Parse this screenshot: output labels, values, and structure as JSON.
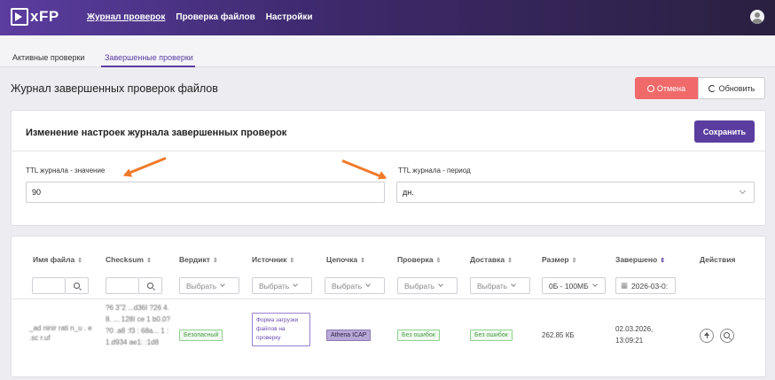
{
  "app": {
    "logo_text": "xFP"
  },
  "topnav": [
    "Журнал проверок",
    "Проверка файлов",
    "Настройки"
  ],
  "tabs": [
    "Активные проверки",
    "Завершенные проверки"
  ],
  "page": {
    "title": "Журнал завершенных проверок файлов",
    "cancel_label": "Отмена",
    "refresh_label": "Обновить"
  },
  "settings": {
    "title": "Изменение настроек журнала завершенных проверок",
    "save_label": "Сохранить",
    "ttl_value_label": "TTL журнала - значение",
    "ttl_value": "90",
    "ttl_period_label": "TTL журнала - период",
    "ttl_period": "дн."
  },
  "table": {
    "columns": [
      "Имя файла",
      "Checksum",
      "Вердикт",
      "Источник",
      "Цепочка",
      "Проверка",
      "Доставка",
      "Размер",
      "Завершено",
      "Действия"
    ],
    "filters": {
      "select_placeholder": "Выбрать",
      "size_filter": "0Б - 100МБ",
      "date_filter": "2026-03-0:"
    },
    "rows": [
      {
        "file_name": "_ad ninir rati n_u . e .sc r.uf",
        "checksum": "?6 3\"2 ...d36I ?26 4. 8. ... 128I ce 1 b0.0? ?0 .a8 :f3 : 68a... 1 : 1.d934 ae1: :1d8",
        "verdict": "Безопасный",
        "source": "Форма загрузки файлов на проверку",
        "chain": "Athena ICAP",
        "check": "Без ошибок",
        "delivery": "Без ошибок",
        "size": "262.85 КБ",
        "finished": "02.03.2026, 13:09:21"
      }
    ]
  },
  "colors": {
    "accent": "#5b3da0",
    "cancel": "#f06a6a",
    "arrow": "#f07a2a"
  }
}
